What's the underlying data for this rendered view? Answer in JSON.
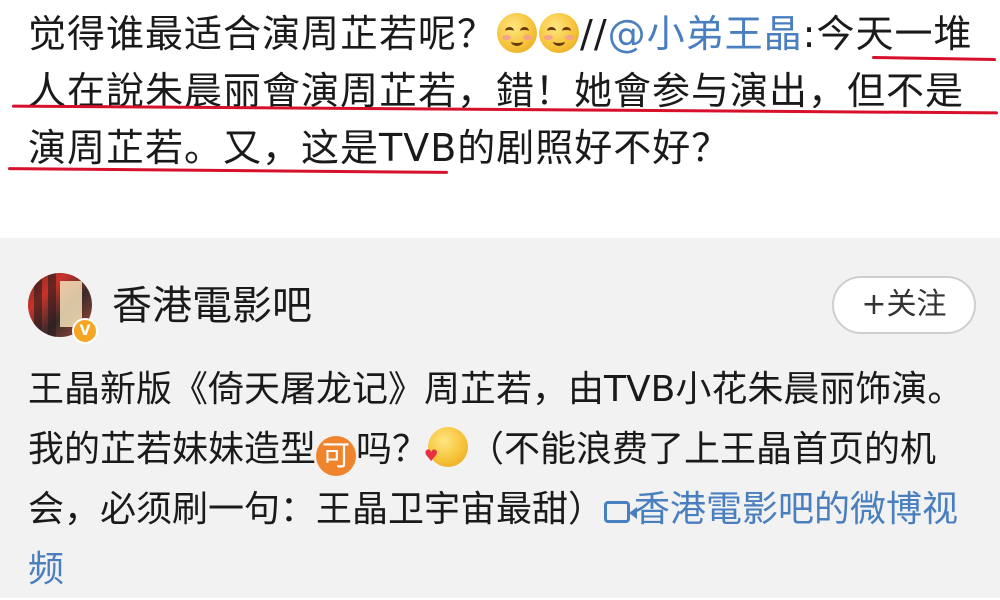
{
  "post": {
    "text_part1": "觉得谁最适合演周芷若呢？",
    "text_part2": "//",
    "mention": "@小弟王晶",
    "text_part3": ":今天一堆人在說朱晨丽會演周芷若，錯！她會参与演出，但不是演周芷若。又，这是TVB的剧照好不好？",
    "emojis": [
      "smile-emoji",
      "smile-emoji"
    ],
    "underline_color": "#d8102b",
    "link_color": "#4a7fbf"
  },
  "repost": {
    "account_name": "香港電影吧",
    "verified_badge": "V",
    "follow_button": "+关注",
    "text_part1": "王晶新版《倚天屠龙记》周芷若，由TVB小花朱晨丽饰演。我的芷若妹妹造型",
    "ke_badge": "可",
    "text_part2": "吗？",
    "text_part3": "（不能浪费了上王晶首页的机会，必须刷一句：王晶卫宇宙最甜）",
    "video_link": "香港電影吧的微博视频",
    "background": "#f2f2f2"
  }
}
